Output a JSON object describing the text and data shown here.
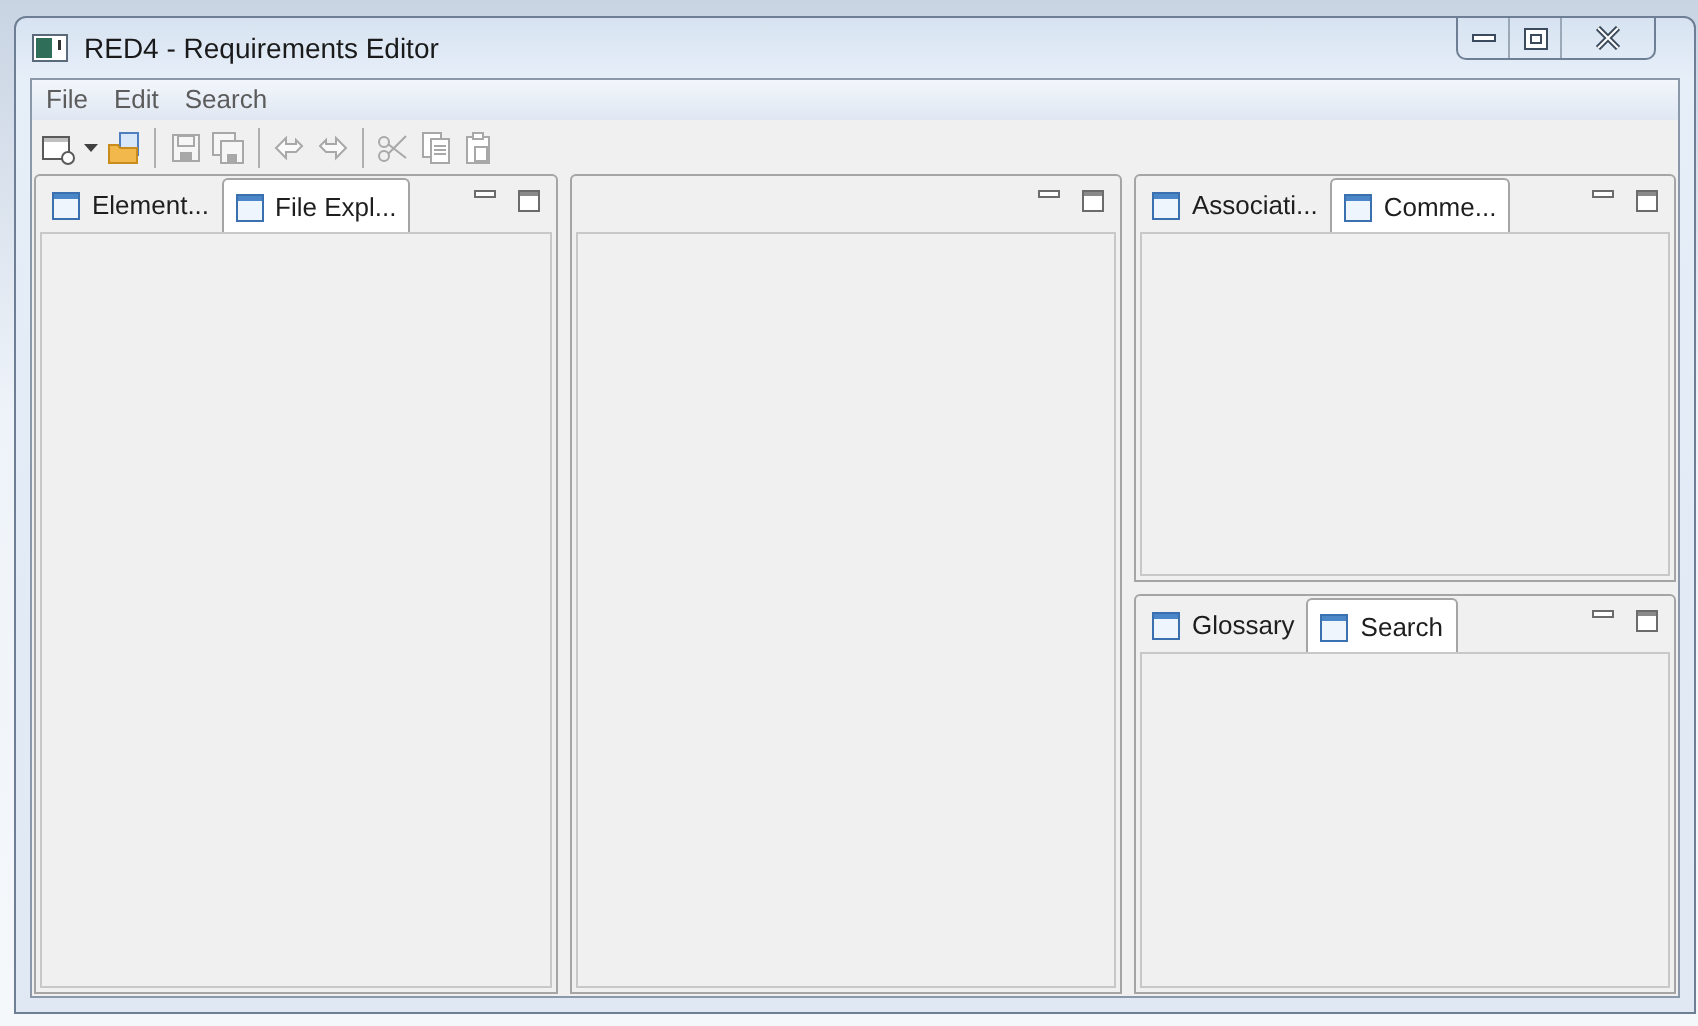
{
  "window": {
    "title": "RED4 - Requirements Editor"
  },
  "menu": [
    "File",
    "Edit",
    "Search"
  ],
  "toolbar": [
    {
      "kind": "new",
      "disabled": false
    },
    {
      "kind": "dropdown",
      "disabled": false
    },
    {
      "kind": "open",
      "disabled": false
    },
    {
      "kind": "separator"
    },
    {
      "kind": "save",
      "disabled": true
    },
    {
      "kind": "save-all",
      "disabled": true
    },
    {
      "kind": "separator"
    },
    {
      "kind": "undo",
      "disabled": true
    },
    {
      "kind": "redo",
      "disabled": true
    },
    {
      "kind": "separator"
    },
    {
      "kind": "cut",
      "disabled": true
    },
    {
      "kind": "copy",
      "disabled": true
    },
    {
      "kind": "paste",
      "disabled": true
    }
  ],
  "left_panel": {
    "tabs": [
      {
        "label": "Element...",
        "selected": false
      },
      {
        "label": "File Expl...",
        "selected": true
      }
    ]
  },
  "right_top_panel": {
    "tabs": [
      {
        "label": "Associati...",
        "selected": false
      },
      {
        "label": "Comme...",
        "selected": true
      }
    ]
  },
  "right_bottom_panel": {
    "tabs": [
      {
        "label": "Glossary",
        "selected": false
      },
      {
        "label": "Search",
        "selected": true
      }
    ]
  }
}
